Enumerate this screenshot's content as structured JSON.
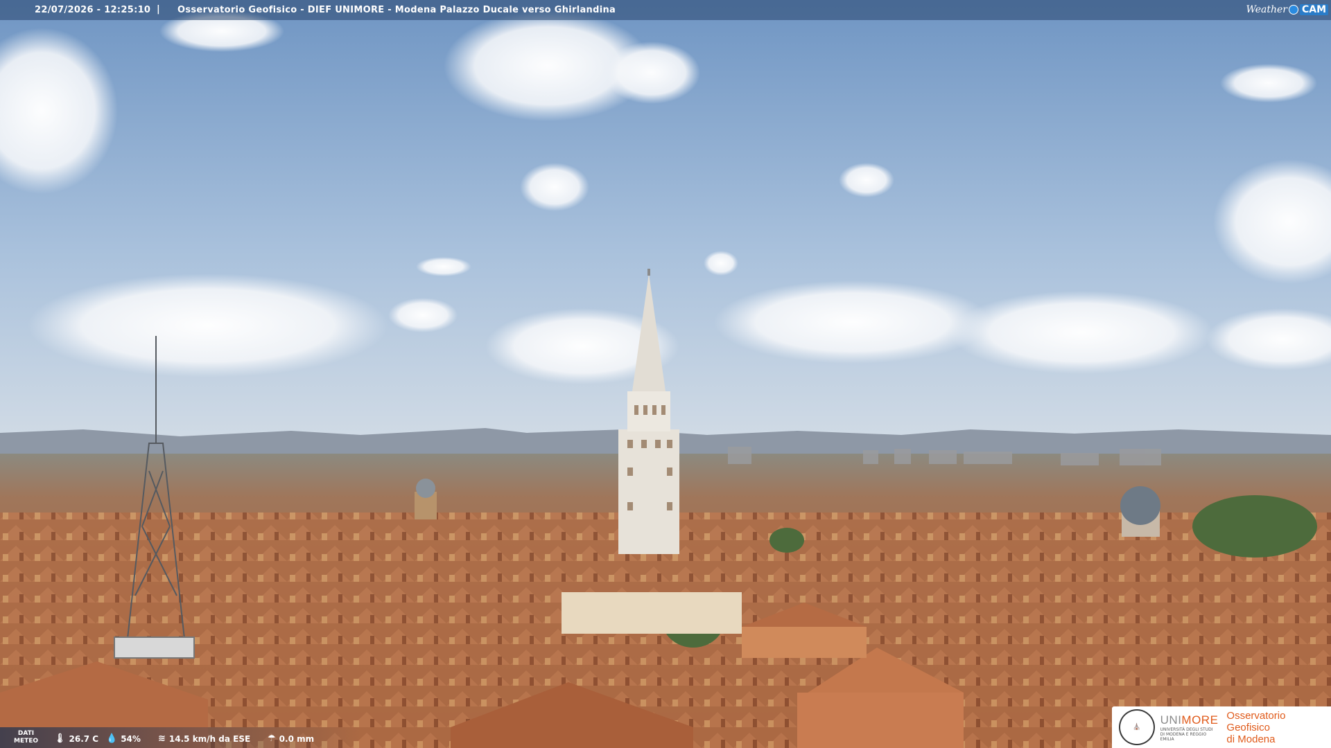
{
  "overlay": {
    "timestamp": "22/07/2026 - 12:25:10",
    "separator": "|",
    "title": "Osservatorio Geofisico - DIEF UNIMORE - Modena Palazzo Ducale verso Ghirlandina",
    "brand_weather": "Weather",
    "brand_cam": "CAM"
  },
  "meteo": {
    "label_line1": "DATI",
    "label_line2": "METEO",
    "temperature": "26.7 C",
    "humidity": "54%",
    "wind": "14.5 km/h da ESE",
    "rain": "0.0 mm"
  },
  "logo": {
    "uni_part1": "UNI",
    "uni_part2": "MORE",
    "uni_sub": "UNIVERSITÀ DEGLI STUDI DI MODENA E REGGIO EMILIA",
    "obs_line1": "Osservatorio Geofisico",
    "obs_line2": "di Modena"
  },
  "colors": {
    "sky_top": "#7fa2cc",
    "sky_horizon": "#c9d6e3",
    "roofs": "#b4714a",
    "tower": "#e4dfd6",
    "accent_orange": "#e05a1a"
  }
}
